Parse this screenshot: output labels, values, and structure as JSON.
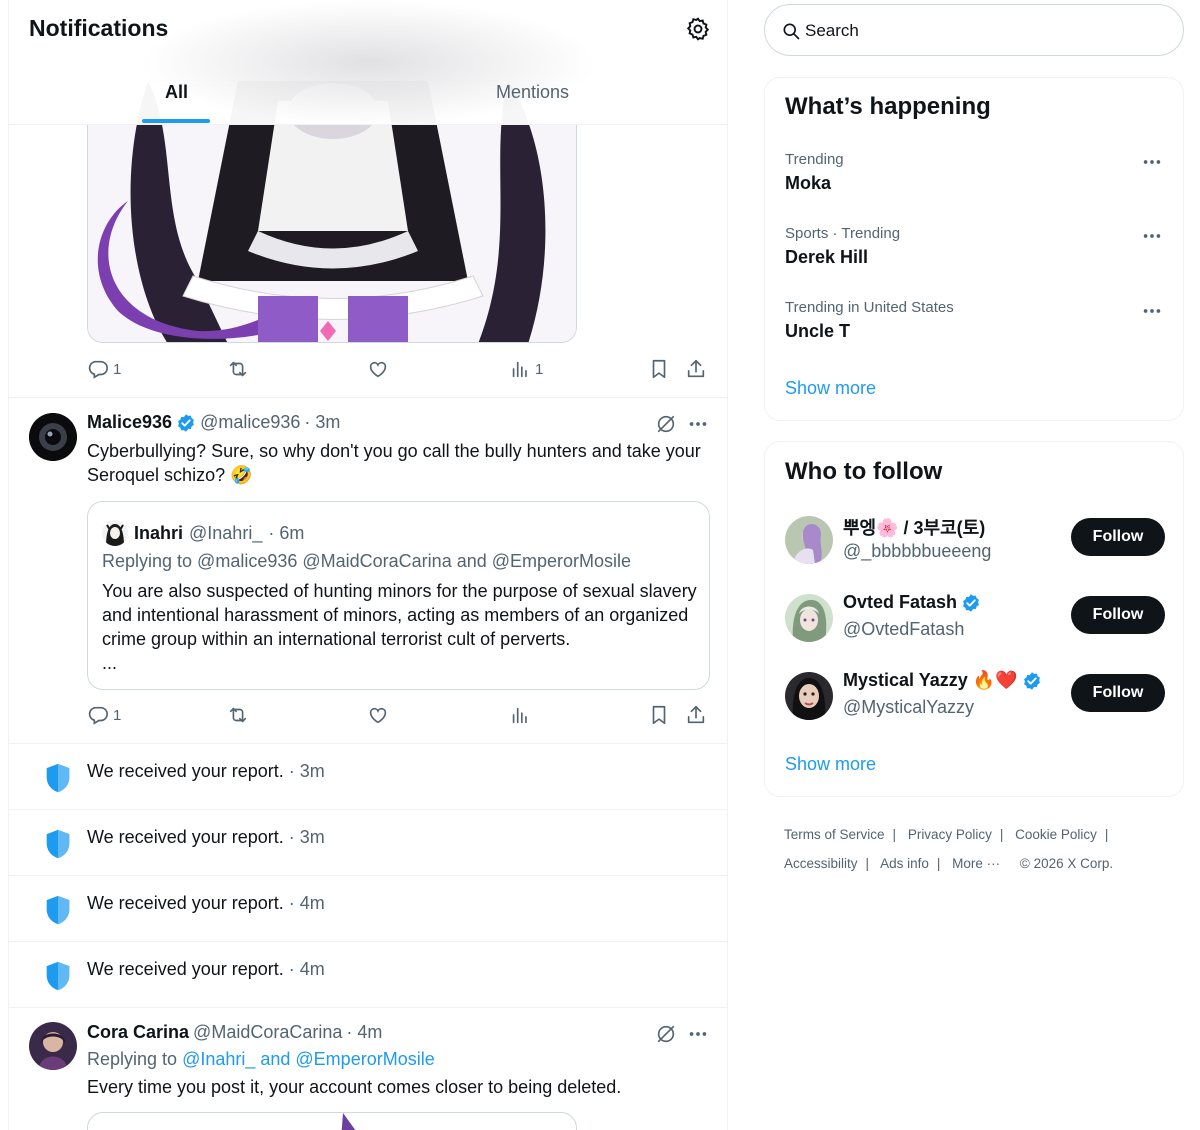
{
  "header": {
    "title": "Notifications",
    "tabs": [
      {
        "label": "All",
        "active": true
      },
      {
        "label": "Mentions",
        "active": false
      }
    ]
  },
  "media_post": {
    "actions": {
      "replies": "1",
      "retweets": "",
      "likes": "",
      "views": "1"
    }
  },
  "post_malice": {
    "name": "Malice936",
    "handle": "@malice936",
    "time": "· 3m",
    "text": "Cyberbullying? Sure, so why don't you go call the bully hunters and take your Seroquel schizo? 🤣",
    "quote": {
      "name": "Inahri",
      "handle": "@Inahri_",
      "time": "· 6m",
      "replying": "Replying to @malice936 @MaidCoraCarina and @EmperorMosile",
      "text": "You are also suspected of hunting minors for the purpose of sexual slavery and intentional harassment of minors, acting as members of an organized crime group within an international terrorist cult of perverts.",
      "ellipsis": "..."
    },
    "actions": {
      "replies": "1",
      "retweets": "",
      "likes": "",
      "views": ""
    }
  },
  "reports": [
    {
      "text": "We received your report.",
      "time": " · 3m"
    },
    {
      "text": "We received your report.",
      "time": " · 3m"
    },
    {
      "text": "We received your report.",
      "time": " · 4m"
    },
    {
      "text": "We received your report.",
      "time": " · 4m"
    }
  ],
  "post_cora": {
    "name": "Cora Carina",
    "handle": "@MaidCoraCarina",
    "time": "· 4m",
    "replying_prefix": "Replying to ",
    "replying_links": "@Inahri_ and @EmperorMosile",
    "text": "Every time you post it, your account comes closer to being deleted."
  },
  "search": {
    "placeholder": "Search"
  },
  "whats_happening": {
    "title": "What’s happening",
    "trends": [
      {
        "category": "Trending",
        "name": "Moka"
      },
      {
        "category": "Sports · Trending",
        "name": "Derek Hill"
      },
      {
        "category": "Trending in United States",
        "name": "Uncle T"
      }
    ],
    "show_more": "Show more"
  },
  "who_to_follow": {
    "title": "Who to follow",
    "accounts": [
      {
        "name": "뿌엥🌸 / 3부코(토)",
        "handle": "@_bbbbbbueeeng",
        "verified": false,
        "button": "Follow"
      },
      {
        "name": "Ovted Fatash",
        "handle": "@OvtedFatash",
        "verified": true,
        "button": "Follow"
      },
      {
        "name": "Mystical Yazzy 🔥❤️",
        "handle": "@MysticalYazzy",
        "verified": true,
        "button": "Follow"
      }
    ],
    "show_more": "Show more"
  },
  "footer": {
    "links": [
      "Terms of Service",
      "Privacy Policy",
      "Cookie Policy",
      "Accessibility",
      "Ads info",
      "More ···"
    ],
    "copyright": "© 2026 X Corp."
  },
  "colors": {
    "accent": "#1d9bf0",
    "text": "#0f1419",
    "secondary": "#536471",
    "border": "#eff3f4",
    "shield": "#1d9bf0"
  }
}
